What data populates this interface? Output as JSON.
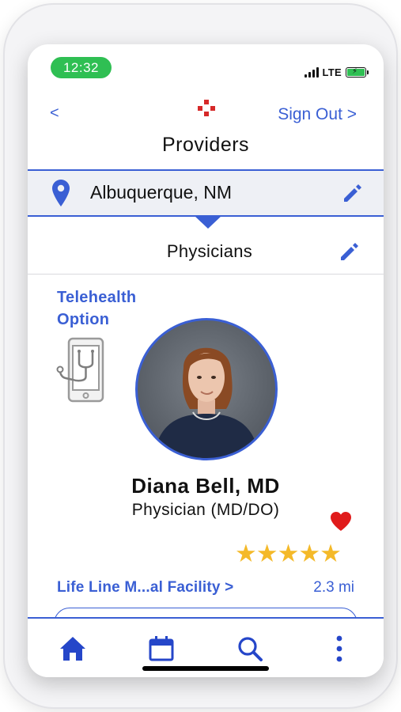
{
  "status_bar": {
    "time": "12:32",
    "network": "LTE"
  },
  "nav": {
    "back_label": "<",
    "sign_out_label": "Sign Out >",
    "title": "Providers"
  },
  "location": {
    "value": "Albuquerque, NM",
    "icon": "map-pin-icon",
    "edit_icon": "pencil-icon"
  },
  "category": {
    "value": "Physicians",
    "edit_icon": "pencil-icon"
  },
  "provider": {
    "telehealth_line1": "Telehealth",
    "telehealth_line2": "Option",
    "name": "Diana Bell, MD",
    "title": "Physician (MD/DO)",
    "favorited": true,
    "rating": 5,
    "rating_max": 5,
    "stars": "★★★★★",
    "facility": "Life Line M...al Facility >",
    "distance": "2.3 mi"
  },
  "tab_bar": {
    "items": [
      {
        "icon": "home-icon",
        "active": true
      },
      {
        "icon": "calendar-icon",
        "active": false
      },
      {
        "icon": "search-icon",
        "active": false
      },
      {
        "icon": "more-vertical-icon",
        "active": false
      }
    ]
  },
  "colors": {
    "accent": "#3a5fd4",
    "time_pill": "#2fbf53",
    "star": "#f4b929",
    "heart": "#e01b1b",
    "logo": "#d62929"
  }
}
